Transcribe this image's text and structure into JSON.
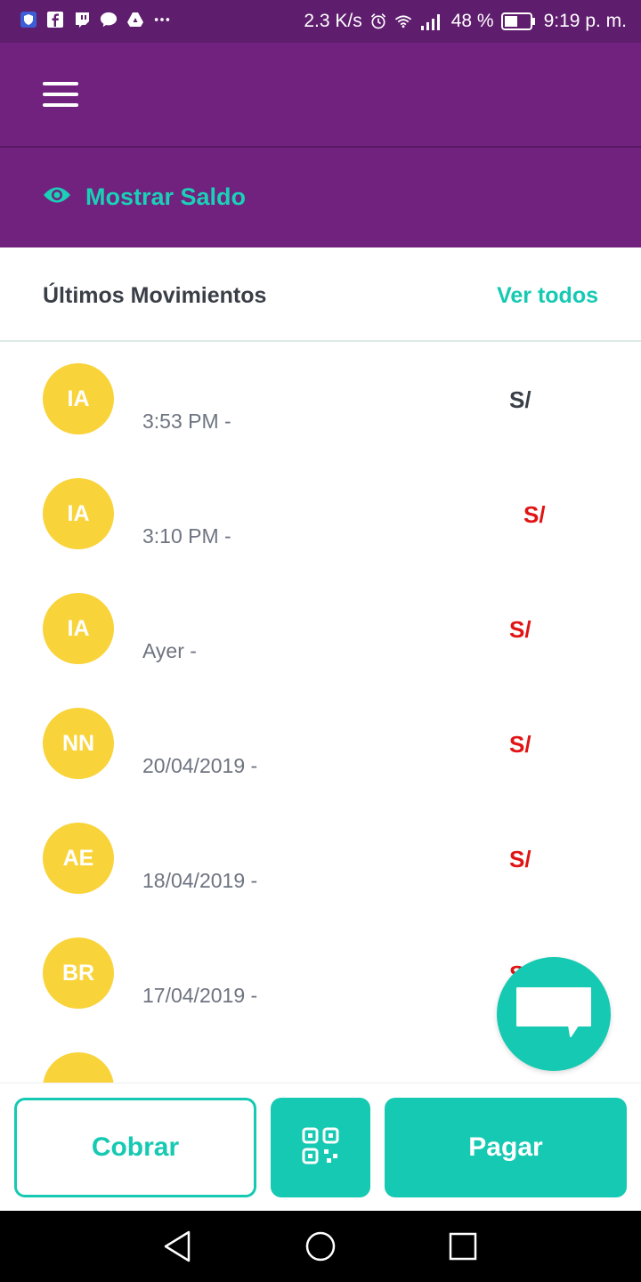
{
  "status_bar": {
    "network_speed": "2.3 K/s",
    "battery": "48 %",
    "time": "9:19 p. m.",
    "icons": [
      "shield-icon",
      "facebook-icon",
      "twitch-icon",
      "chat-bubble-icon",
      "drive-icon",
      "more-icon",
      "alarm-icon",
      "wifi-icon",
      "signal-icon",
      "battery-icon"
    ]
  },
  "header": {
    "menu_icon": "hamburger-icon"
  },
  "balance": {
    "label": "Mostrar Saldo",
    "icon": "eye-icon"
  },
  "movements": {
    "title": "Últimos Movimientos",
    "see_all": "Ver todos",
    "items": [
      {
        "initials": "IA",
        "subtitle": "3:53 PM -",
        "amount": "S/",
        "amount_color": "#3a3f47"
      },
      {
        "initials": "IA",
        "subtitle": "3:10 PM -",
        "amount": "S/",
        "amount_color": "#e01414"
      },
      {
        "initials": "IA",
        "subtitle": "Ayer -",
        "amount": "S/",
        "amount_color": "#e01414"
      },
      {
        "initials": "NN",
        "subtitle": "20/04/2019 -",
        "amount": "S/",
        "amount_color": "#e01414"
      },
      {
        "initials": "AE",
        "subtitle": "18/04/2019 -",
        "amount": "S/",
        "amount_color": "#e01414"
      },
      {
        "initials": "BR",
        "subtitle": "17/04/2019 -",
        "amount": "S/",
        "amount_color": "#e01414"
      },
      {
        "initials": "",
        "subtitle": "",
        "amount": "",
        "amount_color": "#e01414"
      }
    ]
  },
  "actions": {
    "collect": "Cobrar",
    "qr_icon": "qr-code-icon",
    "pay": "Pagar"
  },
  "fab": {
    "icon": "chat-icon"
  },
  "nav": {
    "back_icon": "back-icon",
    "home_icon": "home-icon",
    "recents_icon": "recents-icon"
  },
  "colors": {
    "primary": "#71217e",
    "status_bar": "#5f1d6e",
    "accent": "#16c9b2",
    "avatar": "#f9d33a",
    "negative": "#e01414"
  }
}
